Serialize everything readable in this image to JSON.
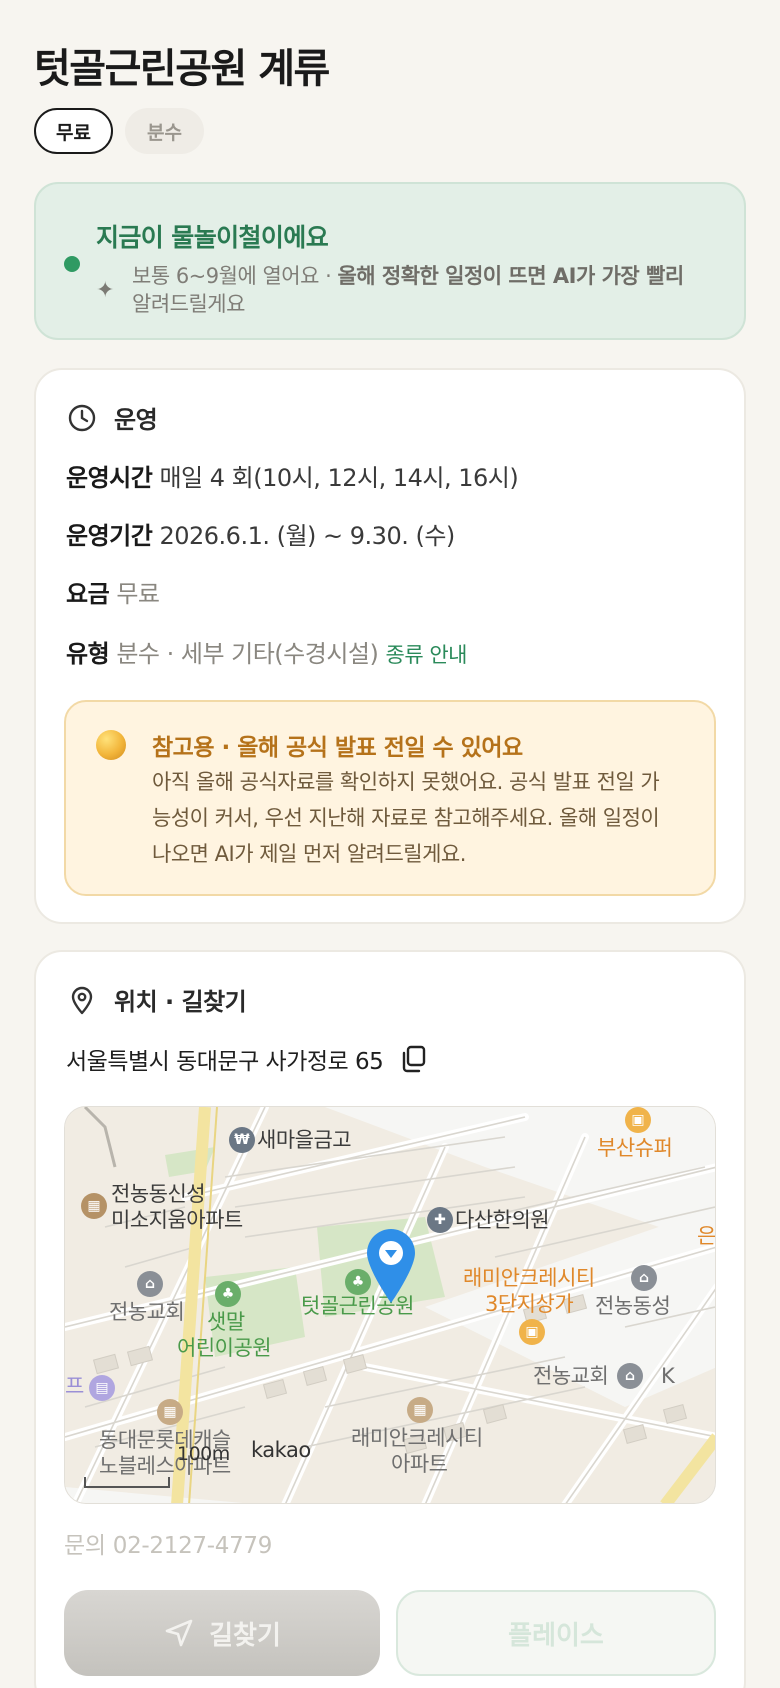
{
  "page": {
    "title": "텃골근린공원 계류",
    "chips": [
      "무료",
      "분수"
    ]
  },
  "season": {
    "headline": "지금이 물놀이철이에요",
    "body_plain": "보통 6~9월에 열어요 · ",
    "body_bold": "올해 정확한 일정이 뜨면 AI가 가장 빨리",
    "body_tail": "알려드릴게요",
    "status_color": "#2f9a63"
  },
  "operation": {
    "heading": "운영",
    "hours_label": "운영시간",
    "hours_value": "매일  4 회(10시, 12시, 14시, 16시)",
    "period_label": "운영기간",
    "period_value": "2026.6.1. (월) ~ 9.30. (수)",
    "fee_label": "요금",
    "fee_value": "무료",
    "type_label": "유형",
    "type_value": "분수 · 세부 기타(수경시설)",
    "type_link": "종류 안내",
    "notice_title": "참고용 · 올해 공식 발표 전일 수 있어요",
    "notice_body": "아직 올해 공식자료를 확인하지 못했어요. 공식 발표 전일 가능성이 커서, 우선 지난해 자료로 참고해주세요. 올해 일정이 나오면 AI가 제일 먼저 알려드릴게요."
  },
  "location": {
    "heading": "위치 · 길찾기",
    "address": "서울특별시 동대문구 사가정로 65",
    "map": {
      "pois": {
        "bank": "새마을금고",
        "apt1_a": "전농동신성",
        "apt1_b": "미소지움아파트",
        "clinic": "다산한의원",
        "church1": "전농교회",
        "park_main": "텃골근린공원",
        "park2_a": "샛말",
        "park2_b": "어린이공원",
        "mall_a": "래미안크레시티",
        "mall_b": "3단지상가",
        "jeonnong_dong": "전농동성",
        "church2": "전농교회",
        "busan": "부산슈퍼",
        "apt2_a": "동대문롯데캐슬",
        "apt2_b": "노블레스아파트",
        "apt3_a": "래미안크레시티",
        "apt3_b": "아파트",
        "edge_left": "프",
        "edge_right1": "은",
        "edge_right2": "K"
      },
      "scale_label": "100m",
      "brand": "kakao"
    },
    "inquiry": "문의 02-2127-4779"
  },
  "actions": {
    "directions": "길찾기",
    "place": "플레이스"
  },
  "colors": {
    "accent_green": "#2a8a5a",
    "warning_orange": "#b5721a",
    "map_pin": "#2f8fe8"
  }
}
